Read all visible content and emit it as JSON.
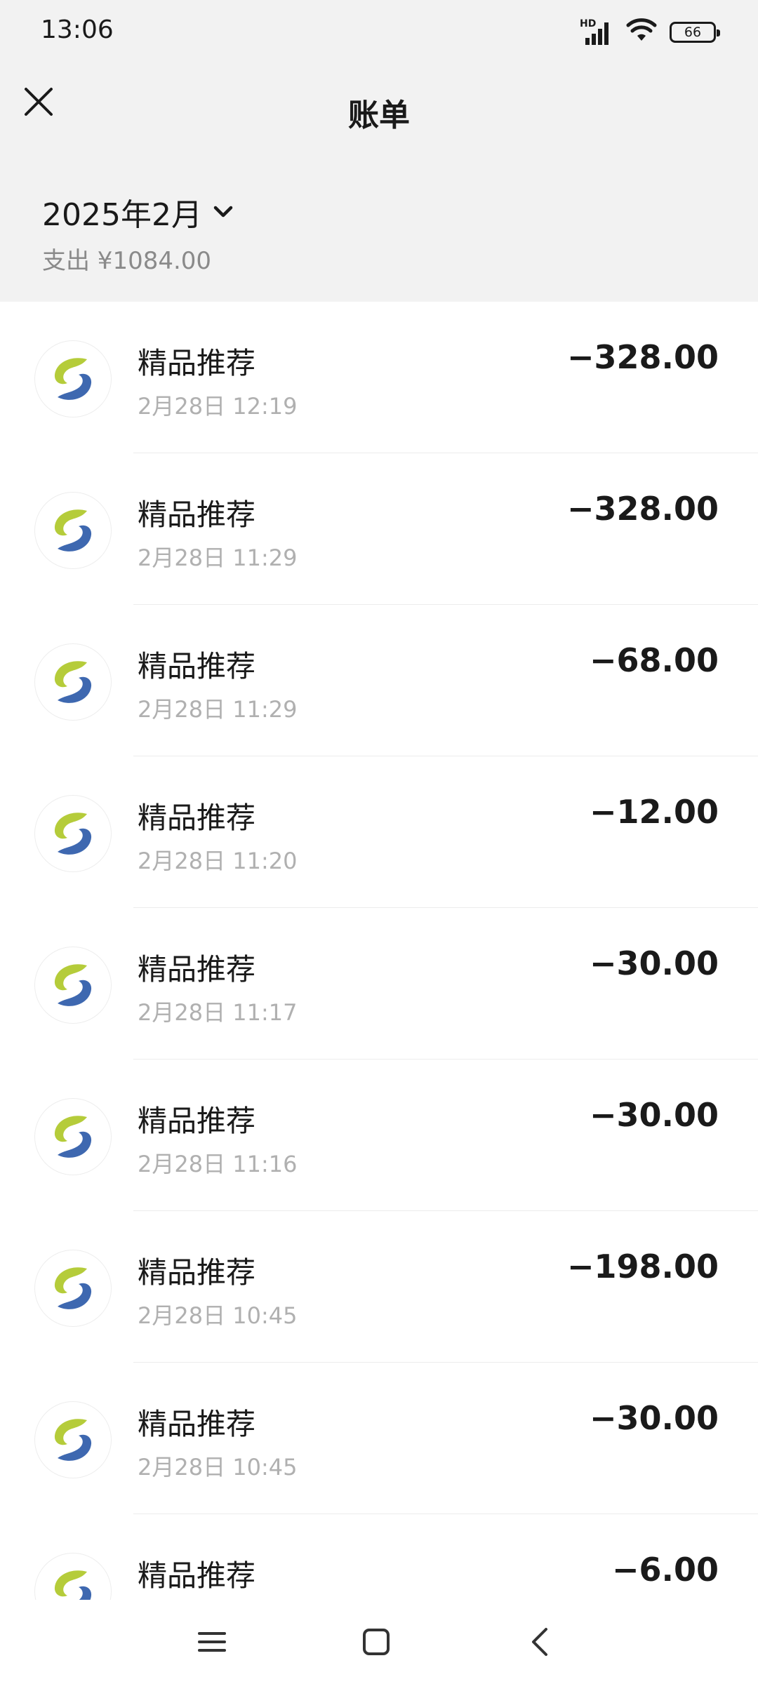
{
  "status_bar": {
    "time": "13:06",
    "hd_label": "HD",
    "battery": "66"
  },
  "nav": {
    "title": "账单",
    "close_icon": "close-icon"
  },
  "summary": {
    "month": "2025年2月",
    "expense": "支出 ¥1084.00"
  },
  "colors": {
    "background": "#f2f2f2",
    "text": "#1a1a1a",
    "secondary": "#8a8a8a",
    "time": "#b0b0b0",
    "logo_green": "#b5cc3a",
    "logo_blue": "#3e68b0"
  },
  "bills": [
    {
      "name": "精品推荐",
      "time": "2月28日 12:19",
      "amount": "−328.00"
    },
    {
      "name": "精品推荐",
      "time": "2月28日 11:29",
      "amount": "−328.00"
    },
    {
      "name": "精品推荐",
      "time": "2月28日 11:29",
      "amount": "−68.00"
    },
    {
      "name": "精品推荐",
      "time": "2月28日 11:20",
      "amount": "−12.00"
    },
    {
      "name": "精品推荐",
      "time": "2月28日 11:17",
      "amount": "−30.00"
    },
    {
      "name": "精品推荐",
      "time": "2月28日 11:16",
      "amount": "−30.00"
    },
    {
      "name": "精品推荐",
      "time": "2月28日 10:45",
      "amount": "−198.00"
    },
    {
      "name": "精品推荐",
      "time": "2月28日 10:45",
      "amount": "−30.00"
    },
    {
      "name": "精品推荐",
      "time": "",
      "amount": "−6.00"
    }
  ]
}
